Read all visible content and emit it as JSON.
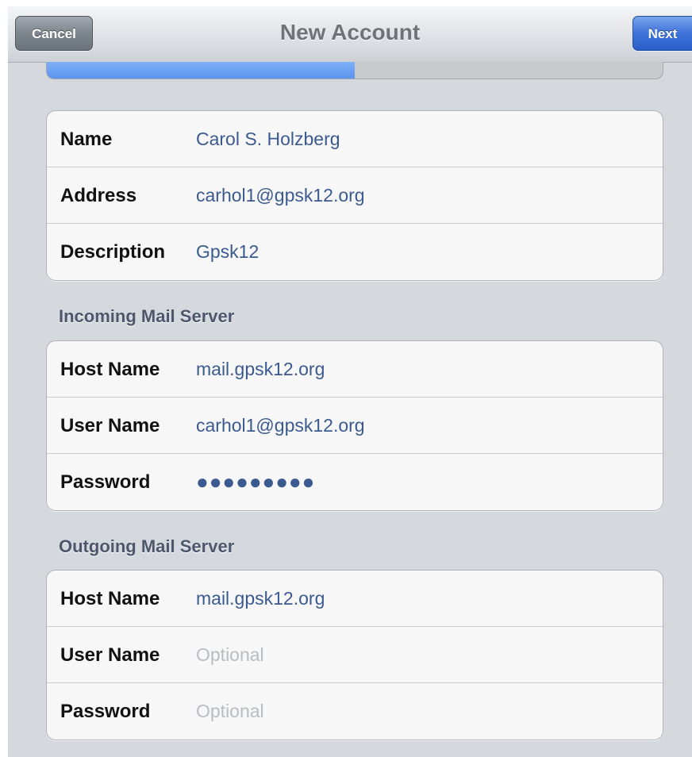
{
  "navbar": {
    "title": "New Account",
    "cancel_label": "Cancel",
    "next_label": "Next"
  },
  "progress": {
    "fraction": 0.5
  },
  "account": {
    "rows": [
      {
        "label": "Name",
        "value": "Carol S. Holzberg"
      },
      {
        "label": "Address",
        "value": "carhol1@gpsk12.org"
      },
      {
        "label": "Description",
        "value": "Gpsk12"
      }
    ]
  },
  "incoming": {
    "header": "Incoming Mail Server",
    "rows": [
      {
        "label": "Host Name",
        "value": "mail.gpsk12.org"
      },
      {
        "label": "User Name",
        "value": "carhol1@gpsk12.org"
      },
      {
        "label": "Password",
        "value": "●●●●●●●●●"
      }
    ]
  },
  "outgoing": {
    "header": "Outgoing Mail Server",
    "rows": [
      {
        "label": "Host Name",
        "value": "mail.gpsk12.org"
      },
      {
        "label": "User Name",
        "placeholder": "Optional"
      },
      {
        "label": "Password",
        "placeholder": "Optional"
      }
    ]
  },
  "colors": {
    "accent": "#3e73d9",
    "value_text": "#3b5a8f",
    "background": "#d5d9dd"
  }
}
